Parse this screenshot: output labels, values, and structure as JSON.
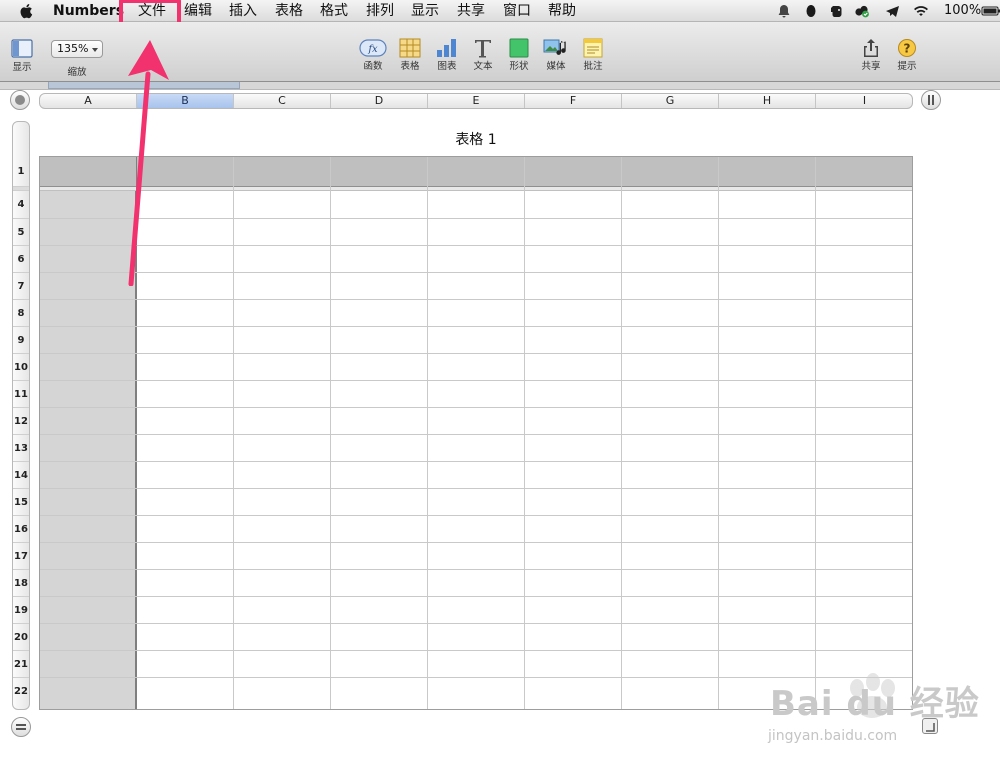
{
  "menubar": {
    "app_name": "Numbers",
    "items": [
      "文件",
      "编辑",
      "插入",
      "表格",
      "格式",
      "排列",
      "显示",
      "共享",
      "窗口",
      "帮助"
    ],
    "battery": "100%",
    "highlight_color": "#f2316f"
  },
  "toolbar": {
    "view_label": "显示",
    "zoom_value": "135%",
    "zoom_label": "缩放",
    "tools": [
      {
        "label": "函数",
        "icon": "function-icon"
      },
      {
        "label": "表格",
        "icon": "table-icon"
      },
      {
        "label": "图表",
        "icon": "chart-icon"
      },
      {
        "label": "文本",
        "icon": "text-icon"
      },
      {
        "label": "形状",
        "icon": "shape-icon"
      },
      {
        "label": "媒体",
        "icon": "media-icon"
      },
      {
        "label": "批注",
        "icon": "comment-icon"
      }
    ],
    "share_label": "共享",
    "tips_label": "提示"
  },
  "sheet": {
    "columns": [
      "A",
      "B",
      "C",
      "D",
      "E",
      "F",
      "G",
      "H",
      "I"
    ],
    "selected_column": "B",
    "rows": [
      "1",
      "4",
      "5",
      "6",
      "7",
      "8",
      "9",
      "10",
      "11",
      "12",
      "13",
      "14",
      "15",
      "16",
      "17",
      "18",
      "19",
      "20",
      "21",
      "22"
    ],
    "table_title": "表格 1"
  },
  "watermark": {
    "brand": "Bai du 经验",
    "url": "jingyan.baidu.com"
  }
}
